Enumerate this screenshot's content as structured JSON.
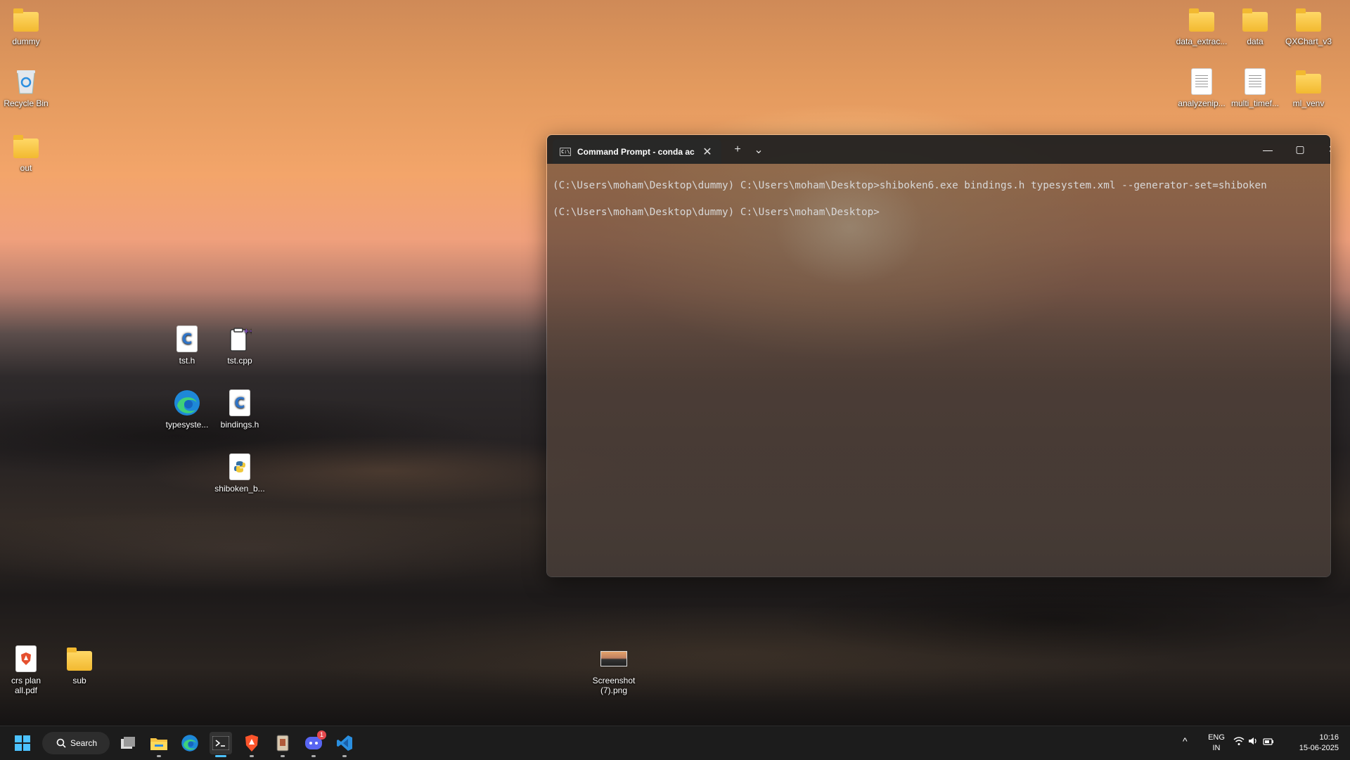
{
  "desktop": {
    "icons_left": [
      {
        "label": "dummy"
      },
      {
        "label": "Recycle Bin"
      },
      {
        "label": "out"
      }
    ],
    "icons_mid": [
      {
        "label": "tst.h"
      },
      {
        "label": "tst.cpp"
      },
      {
        "label": "typesyste..."
      },
      {
        "label": "bindings.h"
      },
      {
        "label": "shiboken_b..."
      }
    ],
    "icons_bottom": [
      {
        "label": "crs plan all.pdf"
      },
      {
        "label": "sub"
      },
      {
        "label": "Screenshot (7).png"
      }
    ],
    "icons_right": [
      {
        "label": "data_extrac..."
      },
      {
        "label": "data"
      },
      {
        "label": "QXChart_v3"
      },
      {
        "label": "analyzenip..."
      },
      {
        "label": "multi_timef..."
      },
      {
        "label": "ml_venv"
      }
    ]
  },
  "terminal": {
    "tab_title": "Command Prompt - conda ac",
    "tab_icon_text": "C:\\",
    "new_tab": "+",
    "dropdown": "⌄",
    "minimize": "—",
    "maximize": "▢",
    "close": "✕",
    "lines": [
      "(C:\\Users\\moham\\Desktop\\dummy) C:\\Users\\moham\\Desktop>shiboken6.exe bindings.h typesystem.xml --generator-set=shiboken",
      "(C:\\Users\\moham\\Desktop\\dummy) C:\\Users\\moham\\Desktop>"
    ]
  },
  "taskbar": {
    "search_label": "Search",
    "discord_badge": "1",
    "language": "ENG",
    "region": "IN",
    "time": "10:16",
    "date": "15-06-2025",
    "tray_chevron": "^"
  }
}
